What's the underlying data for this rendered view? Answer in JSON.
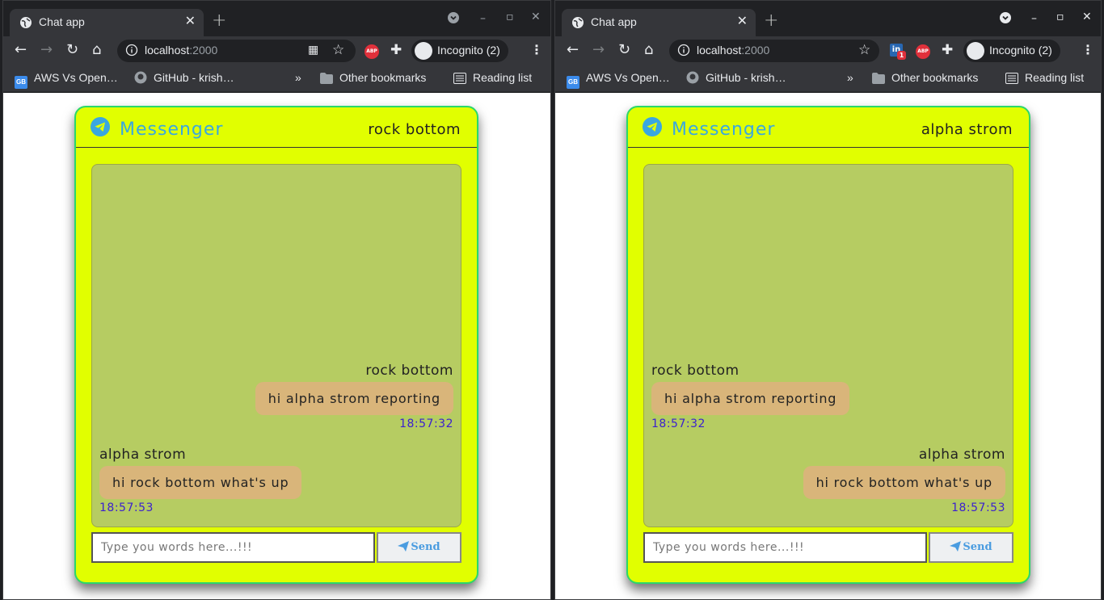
{
  "browser": {
    "tab_title": "Chat app",
    "url_host": "localhost",
    "url_port": ":2000",
    "incognito_label": "Incognito (2)",
    "bookmarks": [
      {
        "label": "AWS Vs Open…",
        "icon": "gb-icon"
      },
      {
        "label": "GitHub - krish…",
        "icon": "github-icon"
      }
    ],
    "overflow_label": "»",
    "other_bookmarks": "Other bookmarks",
    "reading_list": "Reading list",
    "linkedin_badge": "1",
    "abp_label": "ABP"
  },
  "app": {
    "brand": "Messenger",
    "input_placeholder": "Type you words here...!!!",
    "send_label": "Send",
    "accent_color": "#e1ff00",
    "chat_bg_color": "#b6cc62",
    "bubble_color": "#d9b57a"
  },
  "windows": [
    {
      "current_user": "rock bottom",
      "messages": [
        {
          "user": "rock bottom",
          "text": "hi alpha strom reporting",
          "time": "18:57:32",
          "side": "right"
        },
        {
          "user": "alpha strom",
          "text": "hi rock bottom what's up",
          "time": "18:57:53",
          "side": "left"
        }
      ]
    },
    {
      "current_user": "alpha strom",
      "messages": [
        {
          "user": "rock bottom",
          "text": "hi alpha strom reporting",
          "time": "18:57:32",
          "side": "left"
        },
        {
          "user": "alpha strom",
          "text": "hi rock bottom what's up",
          "time": "18:57:53",
          "side": "right"
        }
      ]
    }
  ]
}
